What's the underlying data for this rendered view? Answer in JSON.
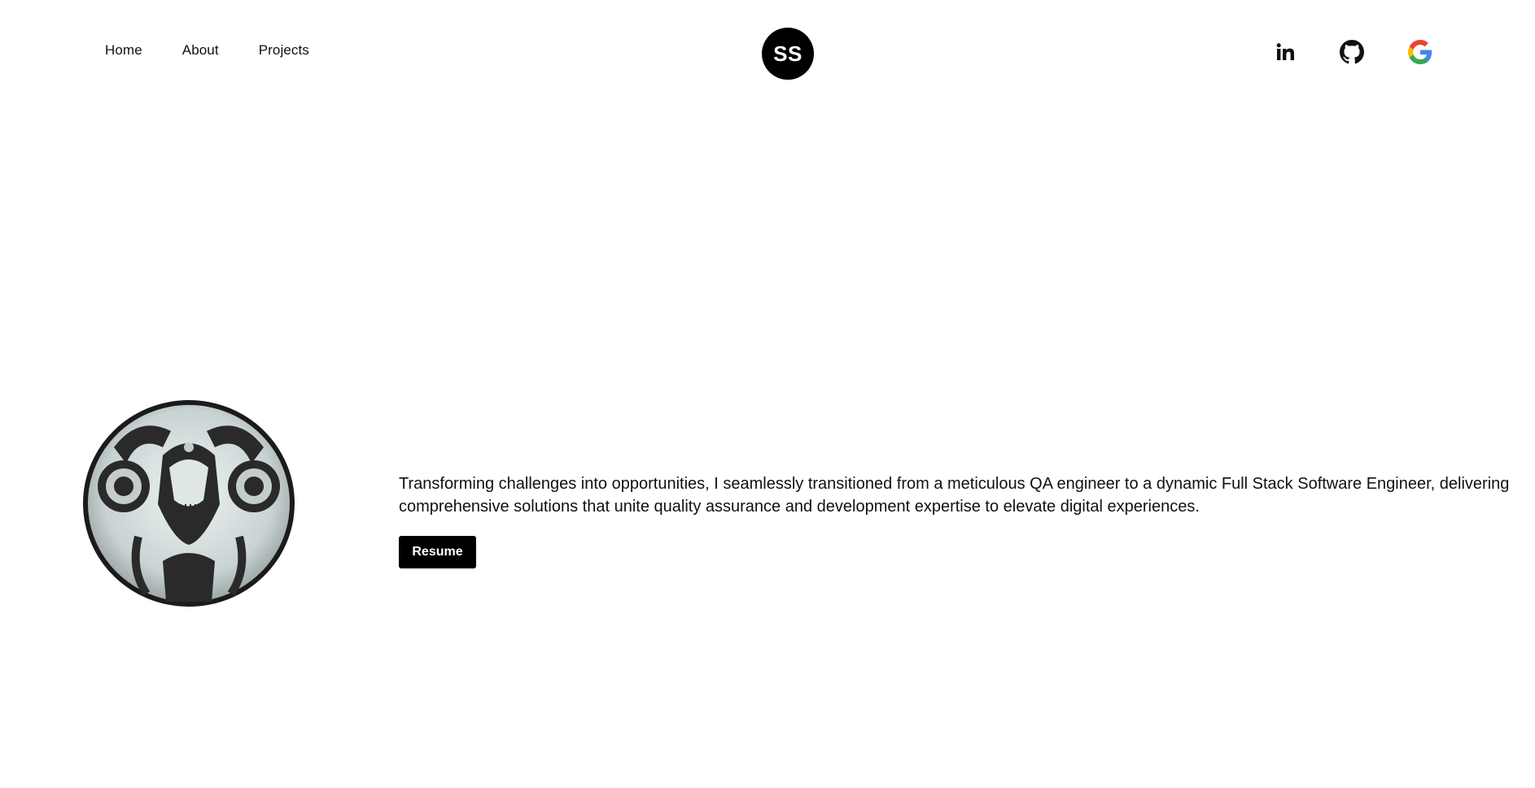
{
  "nav": {
    "items": [
      {
        "label": "Home"
      },
      {
        "label": "About"
      },
      {
        "label": "Projects"
      }
    ]
  },
  "logo": {
    "initials": "SS"
  },
  "social": {
    "icons": [
      "linkedin-icon",
      "github-icon",
      "google-icon"
    ],
    "colors": {
      "google_blue": "#4285F4",
      "google_red": "#EA4335",
      "google_yellow": "#FBBC05",
      "google_green": "#34A853"
    }
  },
  "hero": {
    "description": "Transforming challenges into opportunities, I seamlessly transitioned from a meticulous QA engineer to a dynamic Full Stack Software Engineer, delivering comprehensive solutions that unite quality assurance and development expertise to elevate digital experiences.",
    "resume_label": "Resume"
  },
  "theme": {
    "accent": "#000000",
    "background": "#ffffff"
  }
}
